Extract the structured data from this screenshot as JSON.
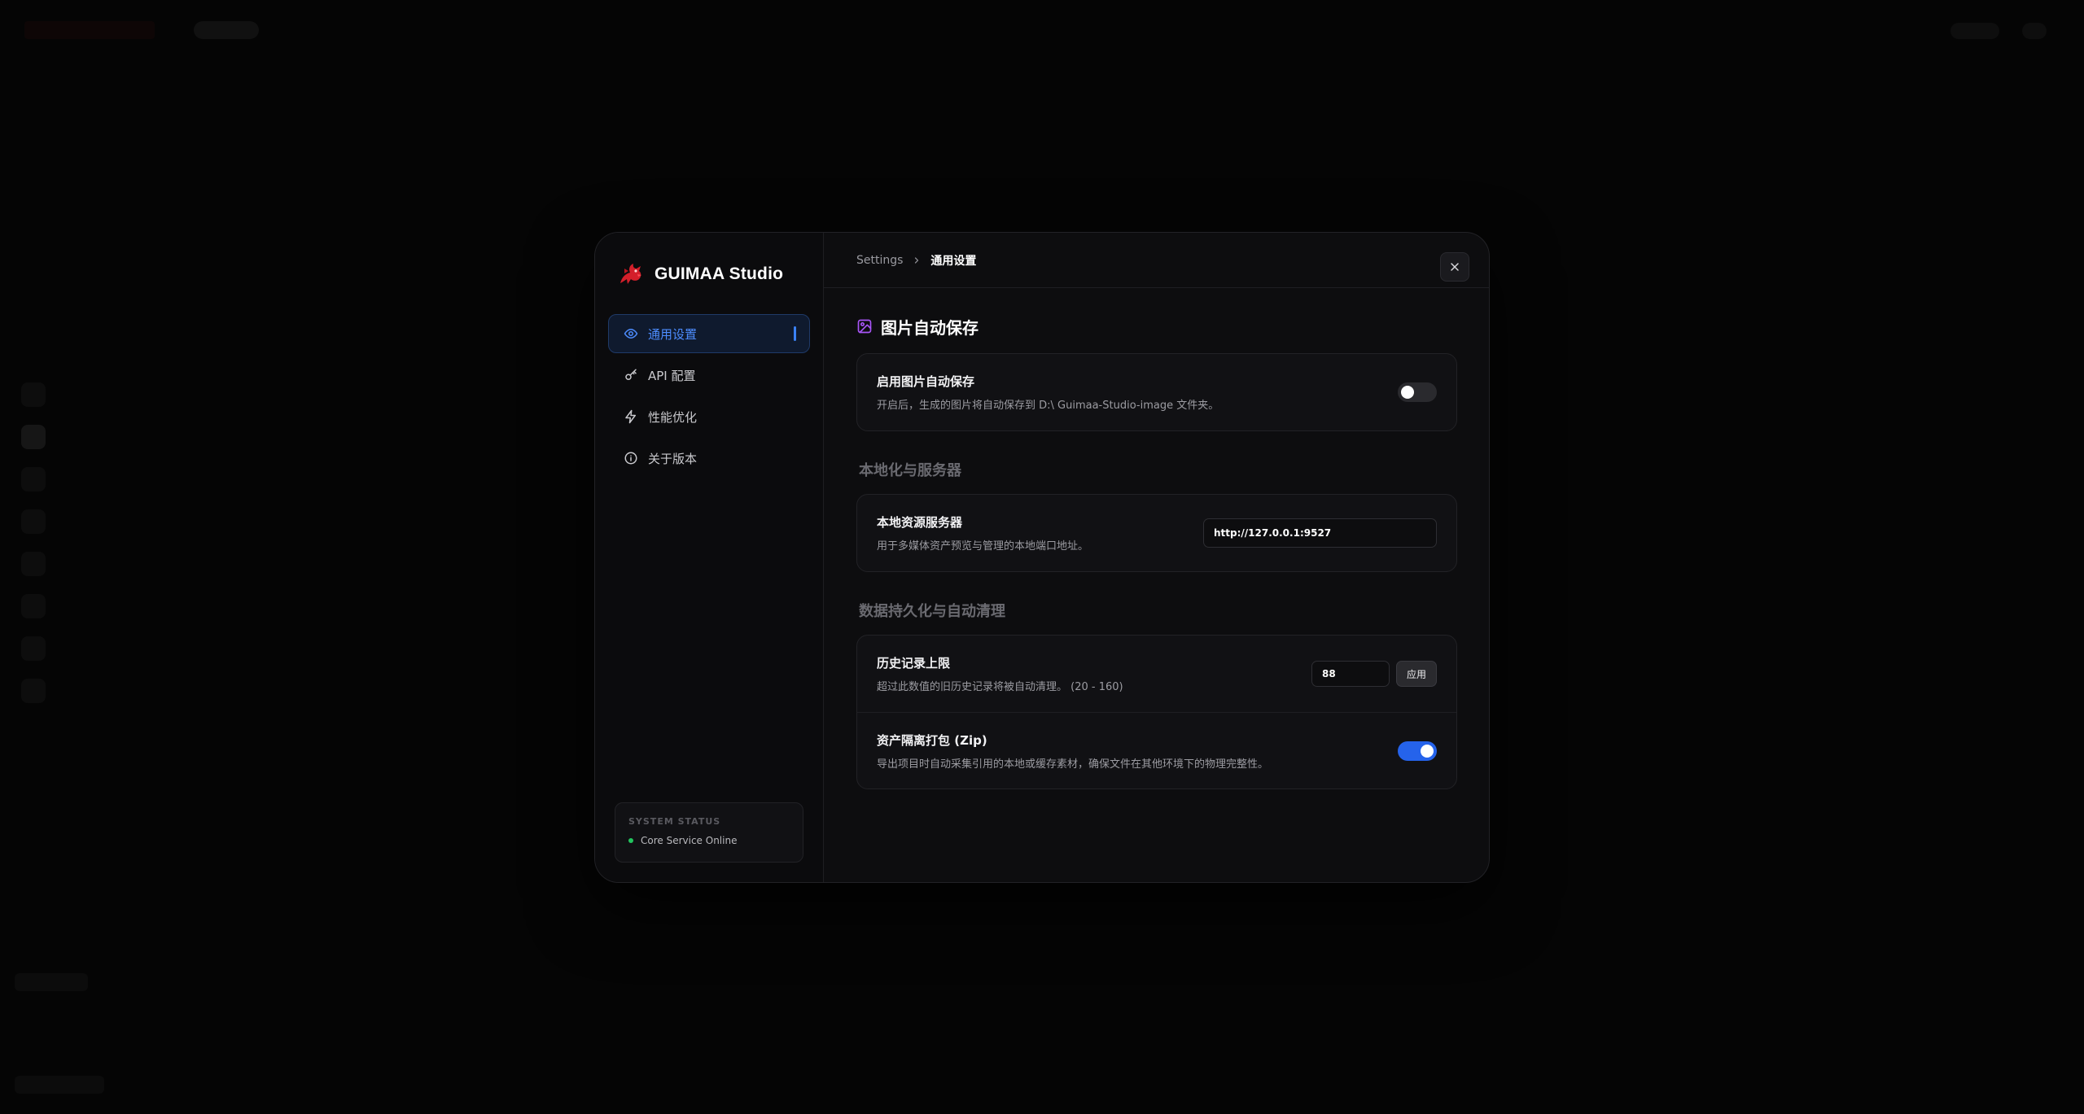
{
  "brand": {
    "name": "GUIMAA Studio",
    "logo_icon": "red-dragon-logo",
    "accent_color": "#e11d2a"
  },
  "sidebar": {
    "items": [
      {
        "label": "通用设置",
        "icon": "eye-icon",
        "active": true
      },
      {
        "label": "API 配置",
        "icon": "key-icon",
        "active": false
      },
      {
        "label": "性能优化",
        "icon": "lightning-icon",
        "active": false
      },
      {
        "label": "关于版本",
        "icon": "info-icon",
        "active": false
      }
    ],
    "status": {
      "title": "SYSTEM STATUS",
      "text": "Core Service Online",
      "color": "#22c55e"
    }
  },
  "header": {
    "breadcrumb_root": "Settings",
    "breadcrumb_current": "通用设置"
  },
  "sections": {
    "image_autosave": {
      "title": "图片自动保存",
      "icon": "image-icon",
      "icon_color": "#a855f7",
      "row": {
        "title": "启用图片自动保存",
        "desc": "开启后，生成的图片将自动保存到 D:\\ Guimaa-Studio-image 文件夹。",
        "enabled": false
      }
    },
    "localization": {
      "title": "本地化与服务器",
      "row": {
        "title": "本地资源服务器",
        "desc": "用于多媒体资产预览与管理的本地端口地址。",
        "value": "http://127.0.0.1:9527"
      }
    },
    "persistence": {
      "title": "数据持久化与自动清理",
      "history": {
        "title": "历史记录上限",
        "desc": "超过此数值的旧历史记录将被自动清理。 (20 - 160)",
        "value": "88",
        "apply_label": "应用"
      },
      "zip": {
        "title": "资产隔离打包 (Zip)",
        "desc": "导出项目时自动采集引用的本地或缓存素材，确保文件在其他环境下的物理完整性。",
        "enabled": true
      }
    }
  },
  "colors": {
    "active_nav": "#4d8dff",
    "toggle_on": "#2563eb"
  }
}
